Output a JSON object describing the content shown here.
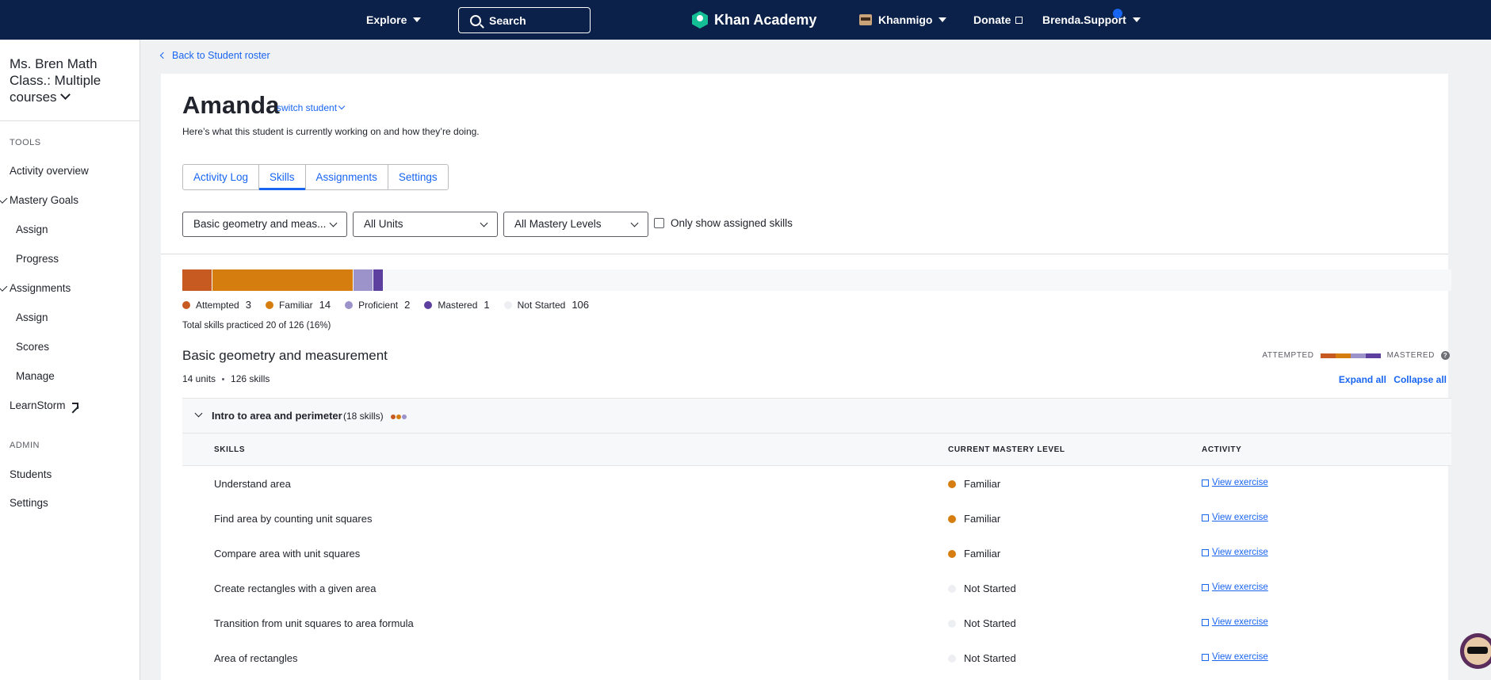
{
  "topnav": {
    "explore": "Explore",
    "search": "Search",
    "logo": "Khan Academy",
    "khanmigo": "Khanmigo",
    "donate": "Donate",
    "user": "Brenda.Support"
  },
  "sidebar": {
    "class_title": "Ms. Bren Math Class.: Multiple courses",
    "tools_label": "TOOLS",
    "activity_overview": "Activity overview",
    "mastery_goals": "Mastery Goals",
    "mg_assign": "Assign",
    "mg_progress": "Progress",
    "assignments": "Assignments",
    "as_assign": "Assign",
    "as_scores": "Scores",
    "as_manage": "Manage",
    "learnstorm": "LearnStorm",
    "admin_label": "ADMIN",
    "students": "Students",
    "settings": "Settings"
  },
  "main": {
    "back": "Back to Student roster",
    "student_name": "Amanda",
    "switch_student": "switch student",
    "subtitle": "Here’s what this student is currently working on and how they’re doing.",
    "tabs": [
      "Activity Log",
      "Skills",
      "Assignments",
      "Settings"
    ],
    "active_tab": "Skills",
    "filters": {
      "course": "Basic geometry and meas...",
      "units": "All Units",
      "mastery": "All Mastery Levels",
      "assigned_only": "Only show assigned skills"
    }
  },
  "mastery_summary": {
    "total_skills": 126,
    "segments": [
      {
        "name": "Attempted",
        "count": "3",
        "color": "#c65a20"
      },
      {
        "name": "Familiar",
        "count": "14",
        "color": "#d67d10"
      },
      {
        "name": "Proficient",
        "count": "2",
        "color": "#9b93c9"
      },
      {
        "name": "Mastered",
        "count": "1",
        "color": "#5c3f9e"
      },
      {
        "name": "Not Started",
        "count": "106",
        "color": "#eeeff2"
      }
    ],
    "total_text": "Total skills practiced 20 of 126 (16%)"
  },
  "course": {
    "title": "Basic geometry and measurement",
    "units": "14 units",
    "skills": "126 skills",
    "scale_left": "ATTEMPTED",
    "scale_right": "MASTERED",
    "help": "?",
    "expand_all": "Expand all",
    "collapse_all": "Collapse all"
  },
  "unit": {
    "title": "Intro to area and perimeter",
    "count": "(18 skills)"
  },
  "table": {
    "headers": {
      "skills": "SKILLS",
      "mastery": "CURRENT MASTERY LEVEL",
      "activity": "ACTIVITY"
    },
    "rows": [
      {
        "skill": "Understand area",
        "mastery": "Familiar",
        "color": "#d67d10",
        "activity": "View exercise"
      },
      {
        "skill": "Find area by counting unit squares",
        "mastery": "Familiar",
        "color": "#d67d10",
        "activity": "View exercise"
      },
      {
        "skill": "Compare area with unit squares",
        "mastery": "Familiar",
        "color": "#d67d10",
        "activity": "View exercise"
      },
      {
        "skill": "Create rectangles with a given area",
        "mastery": "Not Started",
        "color": "#eeeff2",
        "activity": "View exercise"
      },
      {
        "skill": "Transition from unit squares to area formula",
        "mastery": "Not Started",
        "color": "#eeeff2",
        "activity": "View exercise"
      },
      {
        "skill": "Area of rectangles",
        "mastery": "Not Started",
        "color": "#eeeff2",
        "activity": "View exercise"
      }
    ]
  }
}
